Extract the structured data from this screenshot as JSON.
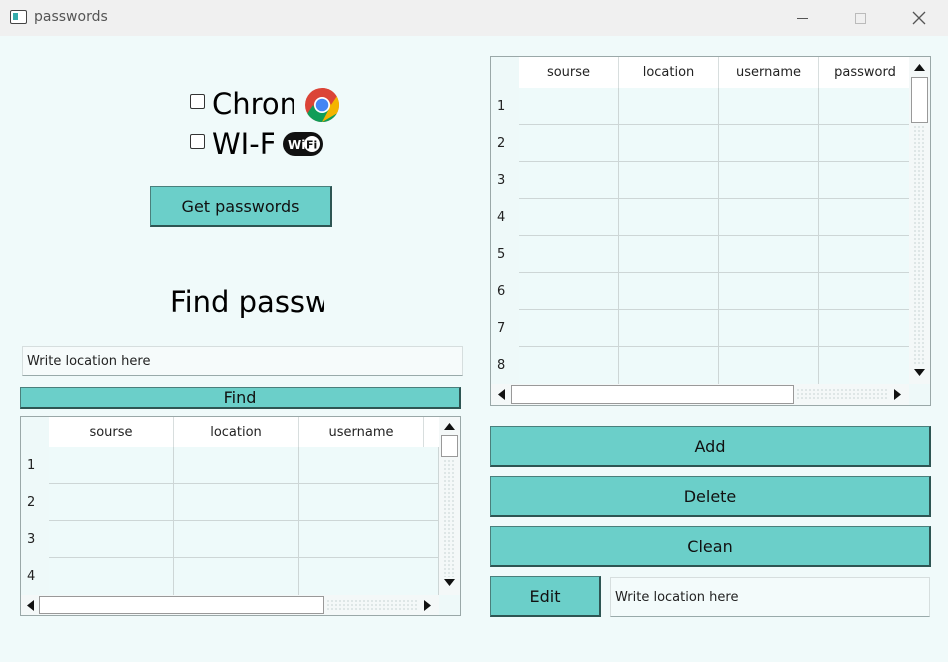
{
  "window": {
    "title": "passwords"
  },
  "sources": {
    "chrome_label": "Chrome",
    "chrome_icon": "chrome-logo-icon",
    "wifi_label": "WI-FI",
    "wifi_icon": "wifi-logo-icon"
  },
  "get_passwords_label": "Get passwords",
  "find_heading": "Find passwords",
  "find_input_placeholder": "Write location here",
  "find_button_label": "Find",
  "main_table": {
    "columns": [
      "sourse",
      "location",
      "username",
      "password"
    ],
    "rows": [
      "1",
      "2",
      "3",
      "4",
      "5",
      "6",
      "7",
      "8"
    ]
  },
  "find_table": {
    "columns": [
      "sourse",
      "location",
      "username"
    ],
    "rows": [
      "1",
      "2",
      "3",
      "4"
    ]
  },
  "actions": {
    "add_label": "Add",
    "delete_label": "Delete",
    "clean_label": "Clean",
    "edit_label": "Edit",
    "edit_input_placeholder": "Write location here"
  },
  "colors": {
    "accent": "#6bcfc9",
    "background": "#f0fafa"
  }
}
